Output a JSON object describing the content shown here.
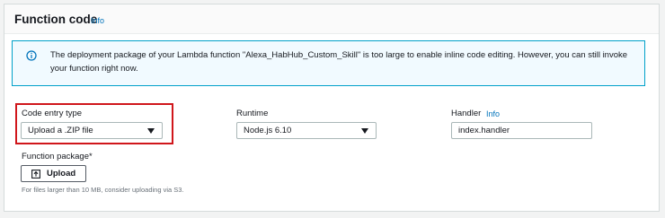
{
  "panel": {
    "title": "Function code",
    "info_link": "Info"
  },
  "alert": {
    "icon": "info-circle-icon",
    "message": "The deployment package of your Lambda function \"Alexa_HabHub_Custom_Skill\" is too large to enable inline code editing. However, you can still invoke your function right now."
  },
  "code_entry": {
    "label": "Code entry type",
    "value": "Upload a .ZIP file"
  },
  "runtime": {
    "label": "Runtime",
    "value": "Node.js 6.10"
  },
  "handler": {
    "label": "Handler",
    "info_link": "Info",
    "value": "index.handler"
  },
  "function_package": {
    "label": "Function package*",
    "upload_label": "Upload",
    "upload_icon": "upload-icon",
    "hint": "For files larger than 10 MB, consider uploading via S3."
  },
  "colors": {
    "accent_link": "#0073bb",
    "alert_border": "#00a1c9",
    "alert_bg": "#f1faff",
    "highlight_border": "#d0161b"
  }
}
